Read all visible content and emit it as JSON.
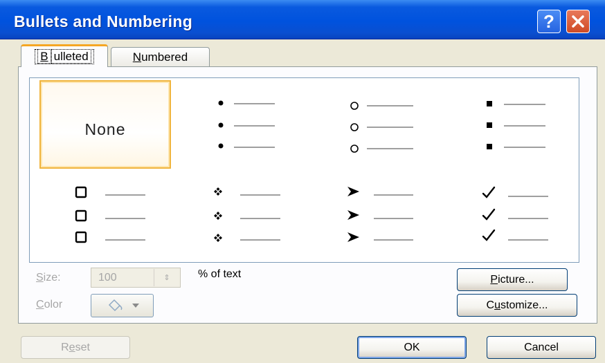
{
  "window": {
    "title": "Bullets and Numbering",
    "help_label": "?"
  },
  "tabs": [
    {
      "label": "Bulleted",
      "accel": "B",
      "rest": "ulleted"
    },
    {
      "label": "Numbered",
      "accel": "N",
      "rest": "umbered"
    }
  ],
  "gallery": {
    "none_label": "None",
    "styles": [
      "filled-round-bullet",
      "hollow-round-bullet",
      "filled-square-bullet",
      "hollow-square-bullet",
      "four-diamond-bullet",
      "arrowhead-bullet",
      "checkmark-bullet"
    ]
  },
  "size": {
    "label_accel": "S",
    "label_rest": "ize:",
    "value": "100",
    "suffix": "% of text"
  },
  "color": {
    "label_accel": "C",
    "label_rest": "olor"
  },
  "buttons": {
    "picture_accel": "P",
    "picture_rest": "icture...",
    "customize_pre": "C",
    "customize_accel": "u",
    "customize_rest": "stomize...",
    "reset_pre": "R",
    "reset_accel": "e",
    "reset_rest": "set",
    "ok": "OK",
    "cancel": "Cancel"
  }
}
